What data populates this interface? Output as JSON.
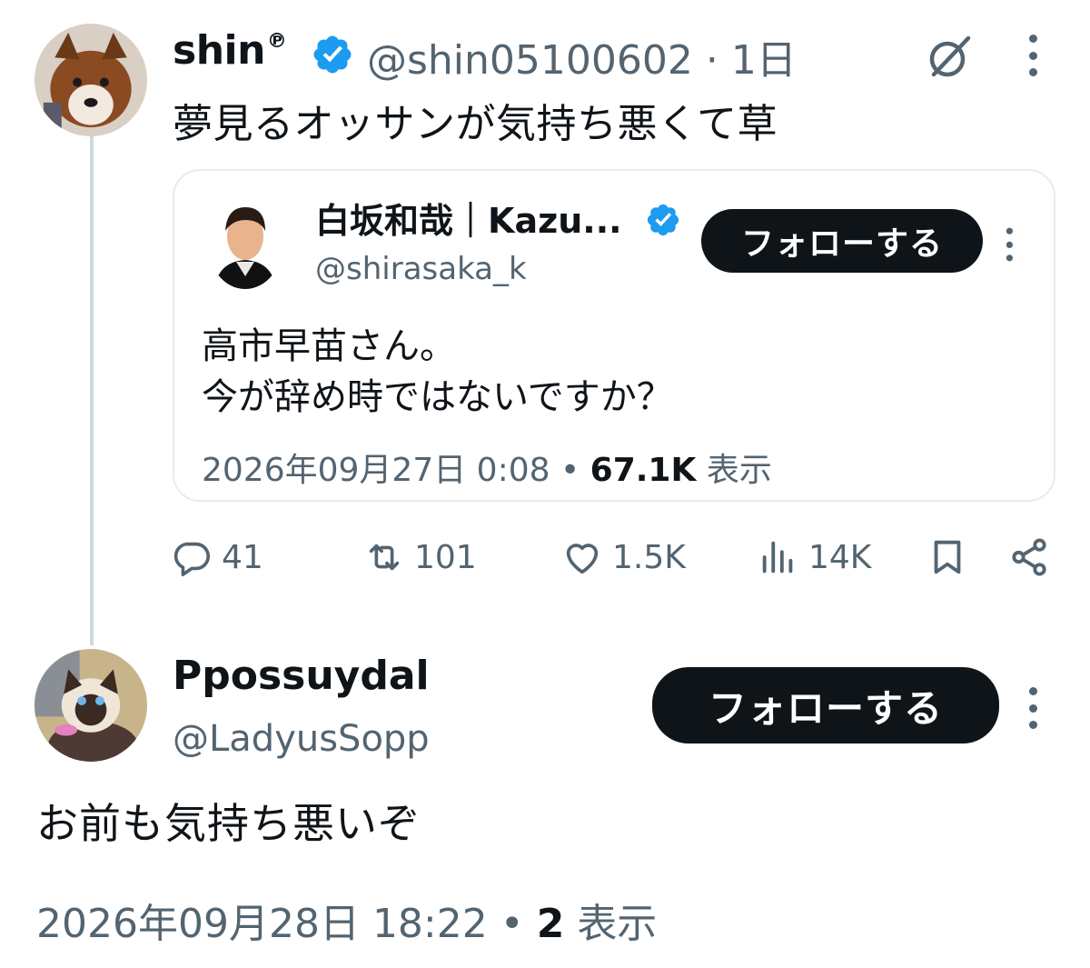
{
  "tweet": {
    "author_name": "shin",
    "author_mark": "℗",
    "handle_time": "@shin05100602 · 1日",
    "text": "夢見るオッサンが気持ち悪くて草",
    "quote": {
      "author_name": "白坂和哉｜Kazu...",
      "handle": "@shirasaka_k",
      "follow_label": "フォローする",
      "text_line1": "高市早苗さん。",
      "text_line2": "今が辞め時ではないですか？",
      "timestamp": "2026年09月27日 0:08 •",
      "views_count": "67.1K",
      "views_label": "表示"
    },
    "actions": {
      "replies": "41",
      "reposts": "101",
      "likes": "1.5K",
      "views": "14K"
    }
  },
  "reply": {
    "author_name": "Ppossuydal",
    "handle": "@LadyusSopp",
    "follow_label": "フォローする",
    "text": "お前も気持ち悪いぞ",
    "timestamp": "2026年09月28日 18:22 •",
    "views_count": "2",
    "views_label": "表示"
  },
  "colors": {
    "text": "#0f1419",
    "secondary": "#536471",
    "verified": "#1d9bf0",
    "thread_line": "#cfd9de"
  }
}
